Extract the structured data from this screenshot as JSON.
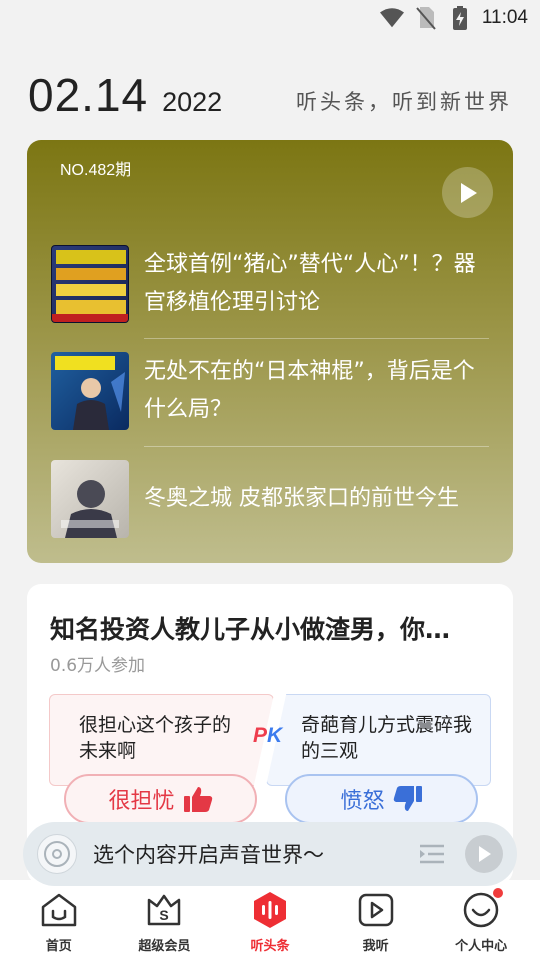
{
  "status_bar": {
    "time": "11:04",
    "icons": [
      "wifi-icon",
      "no-sim-icon",
      "battery-charging-icon"
    ]
  },
  "header": {
    "date": "02.14",
    "year": "2022",
    "slogan": "听头条，听到新世界"
  },
  "episode": {
    "number": "NO.482期",
    "play_icon": "play-icon",
    "items": [
      {
        "title": "全球首例“猪心”替代“人心”！？器官移植伦理引讨论"
      },
      {
        "title": "无处不在的“日本神棍”，背后是个什么局？"
      },
      {
        "title": "冬奥之城 皮都张家口的前世今生"
      }
    ]
  },
  "debate": {
    "title": "知名投资人教儿子从小做渣男，你…",
    "participants": "0.6万人参加",
    "left_option": "很担心这个孩子的未来啊",
    "right_option": "奇葩育儿方式震碎我的三观",
    "pk_p": "P",
    "pk_k": "K",
    "left_button": "很担忧",
    "right_button": "愤怒",
    "colors": {
      "left": "#e43845",
      "right": "#3a6fd8"
    }
  },
  "mini_player": {
    "prompt": "选个内容开启声音世界～"
  },
  "nav": {
    "items": [
      {
        "label": "首页",
        "icon": "home-icon"
      },
      {
        "label": "超级会员",
        "icon": "vip-bag-icon"
      },
      {
        "label": "听头条",
        "icon": "audio-wave-icon",
        "active": true
      },
      {
        "label": "我听",
        "icon": "play-square-icon"
      },
      {
        "label": "个人中心",
        "icon": "smile-face-icon"
      }
    ],
    "accent": "#ee2e34"
  }
}
